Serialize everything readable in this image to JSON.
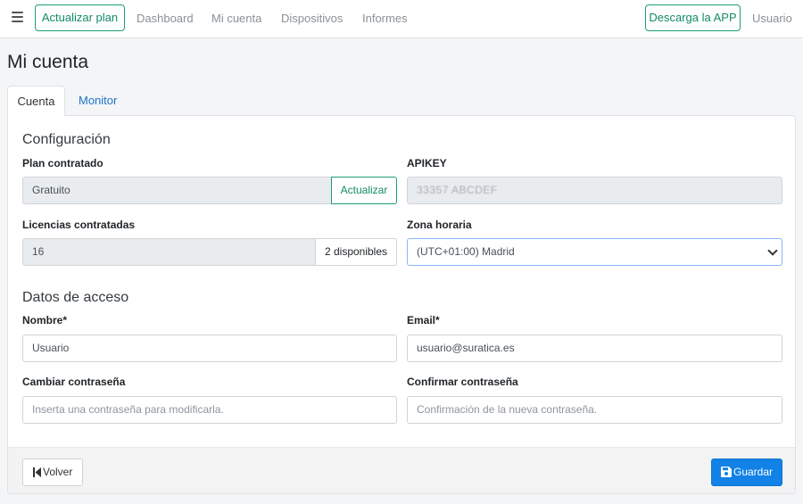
{
  "navbar": {
    "upgrade_button": "Actualizar plan",
    "links": [
      "Dashboard",
      "Mi cuenta",
      "Dispositivos",
      "Informes"
    ],
    "app_button": "Descarga la APP",
    "user_link": "Usuario"
  },
  "page_title": "Mi cuenta",
  "tabs": [
    "Cuenta",
    "Monitor"
  ],
  "configuracion": {
    "title": "Configuración",
    "plan_label": "Plan contratado",
    "plan_value": "Gratuito",
    "plan_action": "Actualizar",
    "apikey_label": "APIKEY",
    "apikey_value": "33357 ABCDEF",
    "licencias_label": "Licencias contratadas",
    "licencias_value": "16",
    "licencias_addon": "2 disponibles",
    "zona_label": "Zona horaria",
    "zona_value": "(UTC+01:00) Madrid"
  },
  "acceso": {
    "title": "Datos de acceso",
    "nombre_label": "Nombre*",
    "nombre_value": "Usuario",
    "email_label": "Email*",
    "email_value": "usuario@suratica.es",
    "pass_label": "Cambiar contraseña",
    "pass_placeholder": "Inserta una contraseña para modificarla.",
    "confirm_label": "Confirmar contraseña",
    "confirm_placeholder": "Confirmación de la nueva contraseña."
  },
  "footer": {
    "back_button": "Volver",
    "save_button": "Guardar"
  },
  "colors": {
    "accent_green": "#1b9e77",
    "primary_blue": "#1282e6",
    "link_blue": "#1a73c8"
  }
}
